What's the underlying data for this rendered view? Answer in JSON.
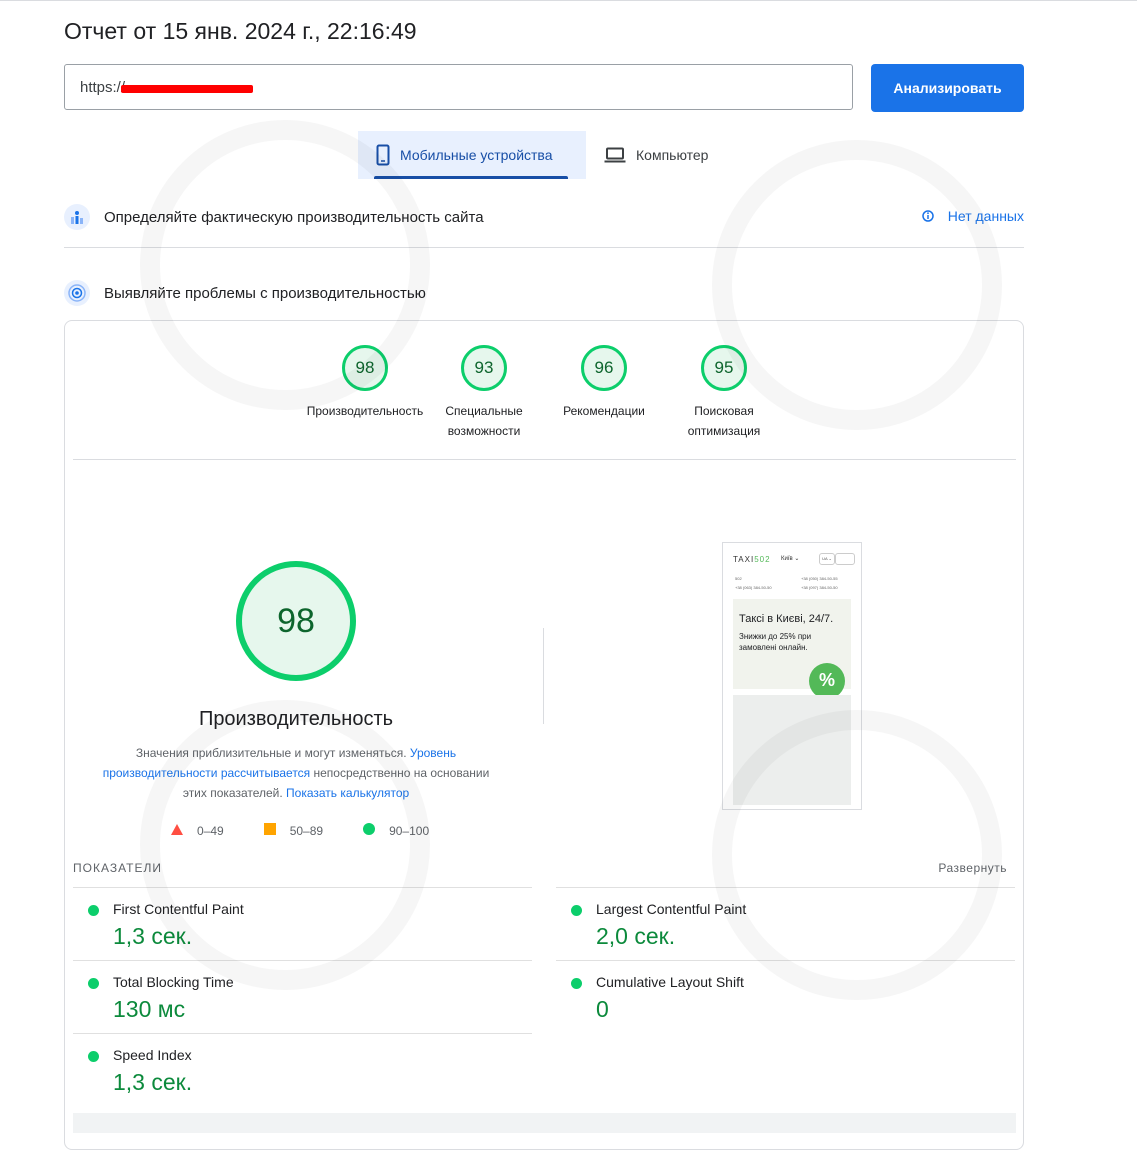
{
  "report": {
    "title": "Отчет от 15 янв. 2024 г., 22:16:49"
  },
  "url_input": {
    "value": "https://"
  },
  "analyze_button": {
    "label": "Анализировать"
  },
  "tabs": [
    {
      "label": "Мобильные устройства",
      "icon": "smartphone-icon",
      "selected": true
    },
    {
      "label": "Компьютер",
      "icon": "laptop-icon",
      "selected": false
    }
  ],
  "field_section": {
    "text": "Определяйте фактическую производительность сайта",
    "no_data_label": "Нет данных"
  },
  "lab_section": {
    "text": "Выявляйте проблемы с производительностью"
  },
  "categories": [
    {
      "score": "98",
      "label": "Производительность"
    },
    {
      "score": "93",
      "label": "Специальные возможности"
    },
    {
      "score": "96",
      "label": "Рекомендации"
    },
    {
      "score": "95",
      "label": "Поисковая оптимизация"
    }
  ],
  "performance": {
    "score": "98",
    "title": "Производительность",
    "desc_text1": "Значения приблизительные и могут изменяться. ",
    "desc_link1": "Уровень производительности рассчитывается",
    "desc_text2": " непосредственно на основании этих показателей. ",
    "desc_link2": "Показать калькулятор"
  },
  "legend": [
    {
      "range": "0–49",
      "color": "#ff4e42",
      "shape": "triangle"
    },
    {
      "range": "50–89",
      "color": "#ffa400",
      "shape": "square"
    },
    {
      "range": "90–100",
      "color": "#0cce6b",
      "shape": "circle"
    }
  ],
  "screenshot": {
    "logo_text": "TAXI",
    "logo_num": "502",
    "city": "Київ ⌄",
    "lang": "UA ⌄",
    "phone1": "502",
    "phone2": "+38 (050) 384-50-55",
    "phone3": "+38 (063) 384-50-50",
    "phone4": "+38 (097) 384-50-50",
    "headline": "Таксі в Києві, 24/7.",
    "subline": "Знижки до 25% при замовлені онлайн.",
    "badge": "%"
  },
  "metrics_header": {
    "label": "ПОКАЗАТЕЛИ",
    "expand_label": "Развернуть"
  },
  "metrics": [
    {
      "name": "First Contentful Paint",
      "value": "1,3 сек.",
      "status_color": "#0cce6b"
    },
    {
      "name": "Largest Contentful Paint",
      "value": "2,0 сек.",
      "status_color": "#0cce6b"
    },
    {
      "name": "Total Blocking Time",
      "value": "130 мс",
      "status_color": "#0cce6b"
    },
    {
      "name": "Cumulative Layout Shift",
      "value": "0",
      "status_color": "#0cce6b"
    },
    {
      "name": "Speed Index",
      "value": "1,3 сек.",
      "status_color": "#0cce6b"
    }
  ],
  "colors": {
    "accent": "#1a73e8",
    "pass": "#0cce6b",
    "pass_text": "#0c8a3c"
  }
}
